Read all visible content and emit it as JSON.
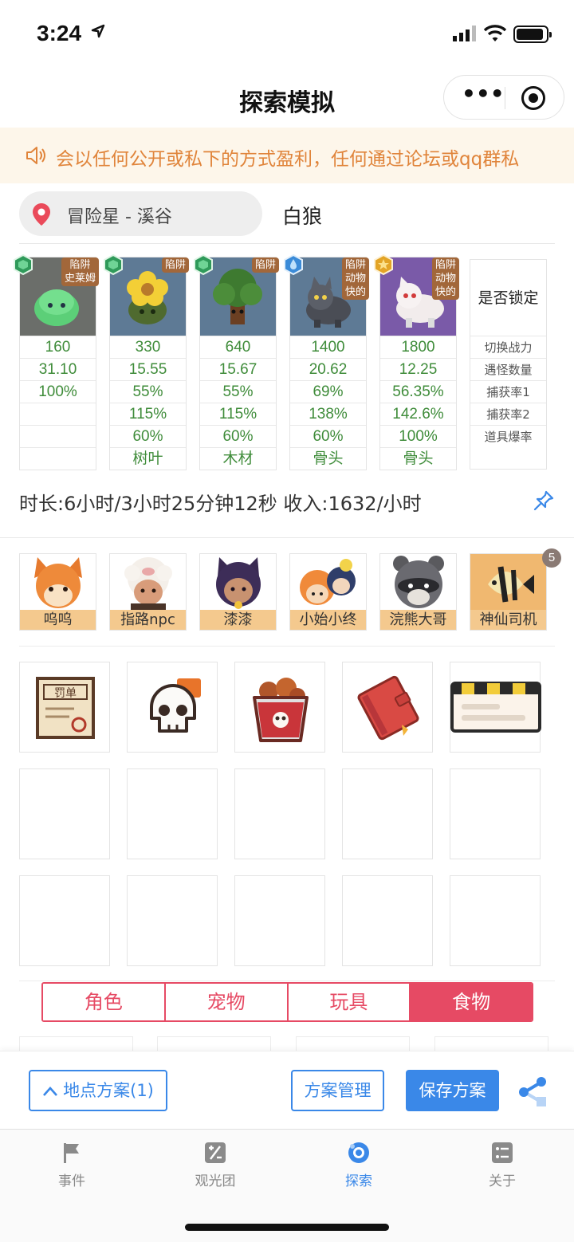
{
  "status": {
    "time": "3:24"
  },
  "nav": {
    "title": "探索模拟"
  },
  "notice": {
    "text": "会以任何公开或私下的方式盈利，任何通过论坛或qq群私"
  },
  "location": {
    "place": "冒险星 - 溪谷",
    "target": "白狼"
  },
  "monsters": [
    {
      "tag": "陷阱\n史莱姆",
      "gem": "green",
      "bg": "#6b6e6a",
      "rows": [
        "160",
        "31.10",
        "100%",
        "",
        "",
        ""
      ]
    },
    {
      "tag": "陷阱",
      "gem": "green",
      "bg": "#5e7a95",
      "rows": [
        "330",
        "15.55",
        "55%",
        "115%",
        "60%",
        "树叶"
      ]
    },
    {
      "tag": "陷阱",
      "gem": "green",
      "bg": "#5e7a95",
      "rows": [
        "640",
        "15.67",
        "55%",
        "115%",
        "60%",
        "木材"
      ]
    },
    {
      "tag": "陷阱\n动物\n快的",
      "gem": "blue",
      "bg": "#5e7a95",
      "rows": [
        "1400",
        "20.62",
        "69%",
        "138%",
        "60%",
        "骨头"
      ]
    },
    {
      "tag": "陷阱\n动物\n快的",
      "gem": "gold",
      "bg": "#7a5aa8",
      "rows": [
        "1800",
        "12.25",
        "56.35%",
        "142.6%",
        "100%",
        "骨头"
      ]
    }
  ],
  "legend": {
    "header": "是否锁定",
    "rows": [
      "切换战力",
      "遇怪数量",
      "捕获率1",
      "捕获率2",
      "道具爆率"
    ]
  },
  "summary": {
    "text": "时长:6小时/3小时25分钟12秒 收入:1632/小时"
  },
  "characters": [
    {
      "name": "呜呜"
    },
    {
      "name": "指路npc"
    },
    {
      "name": "漆漆"
    },
    {
      "name": "小始小终"
    },
    {
      "name": "浣熊大哥"
    },
    {
      "name": "神仙司机",
      "badge": "5"
    }
  ],
  "items": [
    {
      "icon": "penalty-ticket-icon",
      "label": "罚单"
    },
    {
      "icon": "skull-icon"
    },
    {
      "icon": "fried-chicken-bucket-icon"
    },
    {
      "icon": "red-notebook-icon"
    },
    {
      "icon": "striped-card-icon"
    }
  ],
  "tabs": [
    "角色",
    "宠物",
    "玩具",
    "食物"
  ],
  "active_tab": 3,
  "actions": {
    "location_plan": "地点方案(1)",
    "manage": "方案管理",
    "save": "保存方案"
  },
  "tabbar": [
    {
      "label": "事件",
      "icon": "flag-icon"
    },
    {
      "label": "观光团",
      "icon": "calculator-icon"
    },
    {
      "label": "探索",
      "icon": "explore-icon"
    },
    {
      "label": "关于",
      "icon": "list-icon"
    }
  ],
  "colors": {
    "accent": "#3a88e8",
    "tab_red": "#e64a64",
    "value_green": "#3f8c3a",
    "notice_orange": "#e0843a",
    "name_bar": "#f4c98e"
  }
}
